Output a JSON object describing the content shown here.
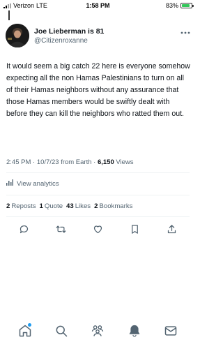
{
  "status_bar": {
    "carrier": "Verizon",
    "network": "LTE",
    "time": "1:58 PM",
    "battery": "83%",
    "battery_level": 0.83
  },
  "tweet": {
    "author_name": "Joe Lieberman is 81",
    "author_handle": "@Citizenroxanne",
    "more_icon": "more-horizontal-icon",
    "text": "It would seem a big catch 22 here is everyone somehow expecting all the non Hamas Palestinians to turn on all of their Hamas neighbors without any assurance that those Hamas members would be swiftly dealt with before they can kill the neighbors who ratted them out.",
    "timestamp": "2:45 PM · 10/7/23 from Earth · ",
    "views_count": "6,150",
    "views_label": " Views",
    "analytics_label": "View analytics",
    "reposts_count": "2",
    "reposts_label": "Reposts",
    "quotes_count": "1",
    "quotes_label": "Quote",
    "likes_count": "43",
    "likes_label": "Likes",
    "bookmarks_count": "2",
    "bookmarks_label": "Bookmarks"
  },
  "actions": [
    "reply-icon",
    "repost-icon",
    "like-icon",
    "bookmark-icon",
    "share-icon"
  ],
  "tab_bar": [
    "home-icon",
    "search-icon",
    "communities-icon",
    "notifications-icon",
    "messages-icon"
  ],
  "colors": {
    "accent": "#1d9bf0",
    "text": "#0f1419",
    "secondary": "#536471",
    "battery": "#32c759"
  }
}
